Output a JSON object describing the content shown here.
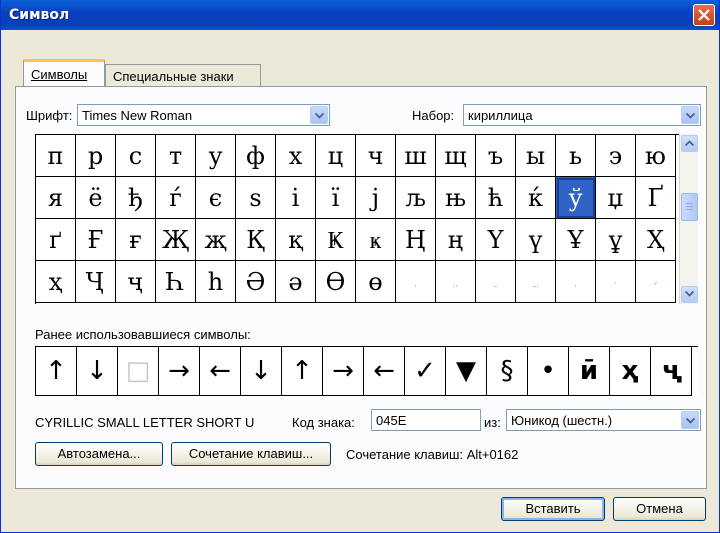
{
  "window": {
    "title": "Символ"
  },
  "tabs": [
    {
      "label": "Символы"
    },
    {
      "label": "Специальные знаки"
    }
  ],
  "font": {
    "label": "Шрифт:",
    "value": "Times New Roman"
  },
  "subset": {
    "label": "Набор:",
    "value": "кириллица"
  },
  "symbols": [
    [
      "п",
      "р",
      "с",
      "т",
      "у",
      "ф",
      "х",
      "ц",
      "ч",
      "ш",
      "щ",
      "ъ",
      "ы",
      "ь",
      "э",
      "ю"
    ],
    [
      "я",
      "ё",
      "ђ",
      "ѓ",
      "є",
      "ѕ",
      "і",
      "ї",
      "ј",
      "љ",
      "њ",
      "ћ",
      "ќ",
      "ў",
      "џ",
      "Ґ"
    ],
    [
      "ґ",
      "Ғ",
      "ғ",
      "Җ",
      "җ",
      "Қ",
      "қ",
      "Ҝ",
      "ҝ",
      "Ң",
      "ң",
      "Ү",
      "ү",
      "Ұ",
      "ұ",
      "Ҳ"
    ],
    [
      "ҳ",
      "Ҷ",
      "ҷ",
      "Һ",
      "һ",
      "Ә",
      "ә",
      "Ө",
      "ө",
      "·",
      "··",
      "–",
      "–·",
      "·",
      "˙",
      "˅"
    ]
  ],
  "selected": {
    "row": 1,
    "col": 13
  },
  "recent": {
    "label": "Ранее использовавшиеся символы:",
    "items": [
      "↑",
      "↓",
      "□",
      "→",
      "←",
      "↓",
      "↑",
      "→",
      "←",
      "✓",
      "▼",
      "§",
      "•",
      "ӣ",
      "ҳ",
      "ҷ"
    ]
  },
  "char_name": "CYRILLIC SMALL LETTER SHORT U",
  "char_code": {
    "label": "Код знака:",
    "value": "045E"
  },
  "from": {
    "label": "из:",
    "value": "Юникод (шестн.)"
  },
  "buttons": {
    "autocorrect": "Автозамена...",
    "shortcut_key": "Сочетание клавиш...",
    "shortcut_text": "Сочетание клавиш: Alt+0162",
    "insert": "Вставить",
    "cancel": "Отмена"
  }
}
